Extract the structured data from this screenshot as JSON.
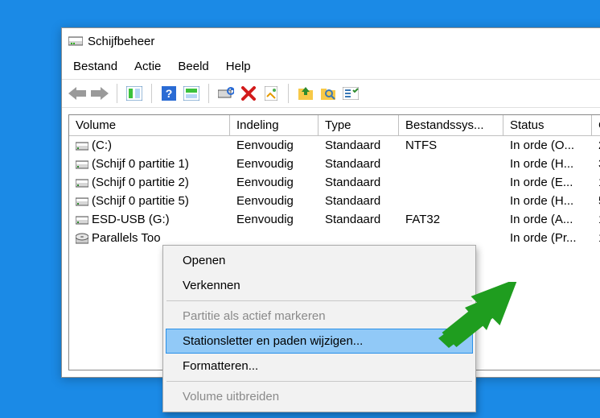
{
  "window": {
    "title": "Schijfbeheer"
  },
  "menubar": [
    "Bestand",
    "Actie",
    "Beeld",
    "Help"
  ],
  "columns": [
    "Volume",
    "Indeling",
    "Type",
    "Bestandssys...",
    "Status",
    "C"
  ],
  "rows": [
    {
      "vol": "(C:)",
      "ind": "Eenvoudig",
      "typ": "Standaard",
      "fs": "NTFS",
      "stat": "In orde (O...",
      "c": "2",
      "icon": "drive"
    },
    {
      "vol": "(Schijf 0 partitie 1)",
      "ind": "Eenvoudig",
      "typ": "Standaard",
      "fs": "",
      "stat": "In orde (H...",
      "c": "3",
      "icon": "drive"
    },
    {
      "vol": "(Schijf 0 partitie 2)",
      "ind": "Eenvoudig",
      "typ": "Standaard",
      "fs": "",
      "stat": "In orde (E...",
      "c": "1",
      "icon": "drive"
    },
    {
      "vol": "(Schijf 0 partitie 5)",
      "ind": "Eenvoudig",
      "typ": "Standaard",
      "fs": "",
      "stat": "In orde (H...",
      "c": "5",
      "icon": "drive"
    },
    {
      "vol": "ESD-USB (G:)",
      "ind": "Eenvoudig",
      "typ": "Standaard",
      "fs": "FAT32",
      "stat": "In orde (A...",
      "c": "1",
      "icon": "drive"
    },
    {
      "vol": "Parallels Too",
      "ind": "",
      "typ": "",
      "fs": "",
      "stat": "In orde (Pr...",
      "c": "1",
      "icon": "disc"
    }
  ],
  "context_menu": [
    {
      "label": "Openen",
      "enabled": true,
      "highlight": false
    },
    {
      "label": "Verkennen",
      "enabled": true,
      "highlight": false
    },
    {
      "sep": true
    },
    {
      "label": "Partitie als actief markeren",
      "enabled": false,
      "highlight": false
    },
    {
      "label": "Stationsletter en paden wijzigen...",
      "enabled": true,
      "highlight": true
    },
    {
      "label": "Formatteren...",
      "enabled": true,
      "highlight": false
    },
    {
      "sep": true
    },
    {
      "label": "Volume uitbreiden",
      "enabled": false,
      "highlight": false
    }
  ]
}
